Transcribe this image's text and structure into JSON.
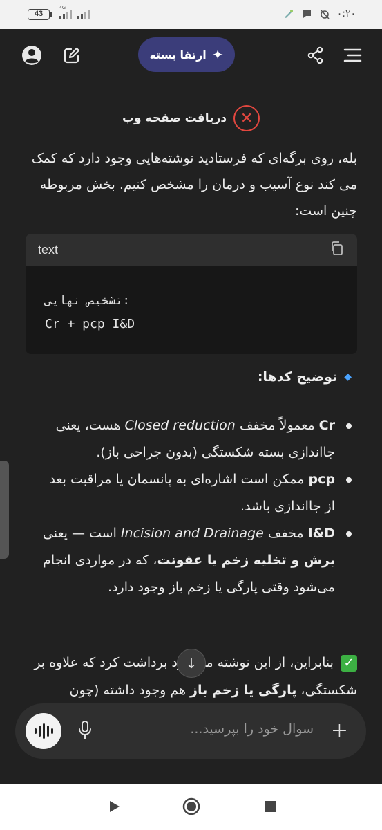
{
  "status_bar": {
    "battery": "43",
    "network": "4G",
    "time": "۰:۲۰"
  },
  "header": {
    "upgrade_label": "ارتقا بسته"
  },
  "tool_call": {
    "label": "دریافت صفحه وب"
  },
  "message": {
    "intro": "بله، روی برگه‌ای که فرستادید نوشته‌هایی وجود دارد که کمک می کند نوع آسیب و درمان را مشخص کنیم. بخش مربوطه چنین است:",
    "code_block": {
      "language": "text",
      "line1": "تشخیص نهایی:",
      "line2": "Cr + pcp I&D"
    },
    "heading": "توضیح کدها:",
    "bullets": [
      {
        "term": "Cr",
        "before": " معمولاً مخفف ",
        "italic": "Closed reduction",
        "after": " هست، یعنی جااندازی بسته شکستگی (بدون جراحی باز)."
      },
      {
        "term": "pcp",
        "text": " ممکن است اشاره‌ای به پانسمان یا مراقبت بعد از جااندازی باشد."
      },
      {
        "term": "I&D",
        "before": " مخفف ",
        "italic": "Incision and Drainage",
        "after": " است — یعنی ",
        "bold2": "برش و تخلیه زخم یا عفونت",
        "after2": "، که در مواردی انجام می‌شود وقتی پارگی یا زخم باز وجود دارد."
      }
    ],
    "conclusion_a": " بنابراین، از این نوشته می‌شود برداشت کرد که علاوه بر شکستگی، ",
    "conclusion_bold": "پارگی یا زخم باز",
    "conclusion_b": " هم وجود داشته (چون"
  },
  "composer": {
    "placeholder": "سوال خود را بپرسید..."
  },
  "colors": {
    "background": "#212121",
    "upgrade_pill": "#3b3d7a",
    "tool_error": "#e2473f",
    "diamond_accent": "#4aa3ff",
    "check": "#3cb043"
  }
}
